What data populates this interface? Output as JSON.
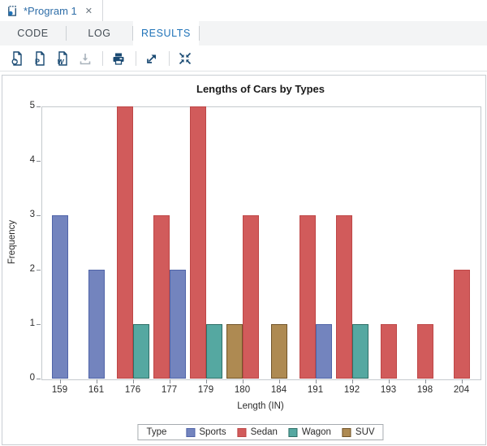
{
  "window": {
    "tab_title": "*Program 1",
    "close_glyph": "✕"
  },
  "subtabs": {
    "items": [
      {
        "label": "CODE"
      },
      {
        "label": "LOG"
      },
      {
        "label": "RESULTS"
      }
    ],
    "active": "RESULTS"
  },
  "toolbar": {
    "icons": [
      "download-html-icon",
      "download-pdf-icon",
      "download-word-icon",
      "download-icon",
      "print-icon",
      "open-new-tab-icon",
      "exit-maximize-icon"
    ],
    "disabled": [
      "download-icon"
    ],
    "pdf_glyph": "P",
    "word_glyph": "W"
  },
  "colors": {
    "accent_blue": "#1E72B8",
    "icon_navy": "#1A4A73",
    "disabled_icon_gray": "#A9B3BC",
    "tab_title_blue": "#2F6EA8"
  },
  "chart_data": {
    "type": "bar",
    "title": "Lengths of Cars by Types",
    "xlabel": "Length (IN)",
    "ylabel": "Frequency",
    "legend_title": "Type",
    "legend_position": "bottom",
    "grid": false,
    "ylim": [
      0,
      5
    ],
    "yticks": [
      0,
      1,
      2,
      3,
      4,
      5
    ],
    "categories": [
      "159",
      "161",
      "176",
      "177",
      "179",
      "180",
      "184",
      "191",
      "192",
      "193",
      "198",
      "204"
    ],
    "series": [
      {
        "name": "Sports",
        "fill": "#7384BE",
        "border": "#5064A8",
        "values": [
          3,
          2,
          0,
          2,
          0,
          0,
          0,
          1,
          0,
          0,
          0,
          0
        ]
      },
      {
        "name": "Sedan",
        "fill": "#D15B5B",
        "border": "#BE4747",
        "values": [
          0,
          0,
          5,
          3,
          5,
          3,
          0,
          3,
          3,
          1,
          1,
          2
        ]
      },
      {
        "name": "Wagon",
        "fill": "#55A8A1",
        "border": "#2F6F67",
        "values": [
          0,
          0,
          1,
          0,
          1,
          0,
          0,
          0,
          1,
          0,
          0,
          0
        ]
      },
      {
        "name": "SUV",
        "fill": "#AE8A52",
        "border": "#72552A",
        "values": [
          0,
          0,
          0,
          0,
          0,
          1,
          1,
          0,
          0,
          0,
          0,
          0
        ]
      }
    ],
    "cluster_order": [
      [
        "Sports"
      ],
      [
        "Sports"
      ],
      [
        "Sedan",
        "Wagon"
      ],
      [
        "Sedan",
        "Sports"
      ],
      [
        "Sedan",
        "Wagon"
      ],
      [
        "SUV",
        "Sedan"
      ],
      [
        "SUV"
      ],
      [
        "Sedan",
        "Sports"
      ],
      [
        "Sedan",
        "Wagon"
      ],
      [
        "Sedan"
      ],
      [
        "Sedan"
      ],
      [
        "Sedan"
      ]
    ]
  }
}
